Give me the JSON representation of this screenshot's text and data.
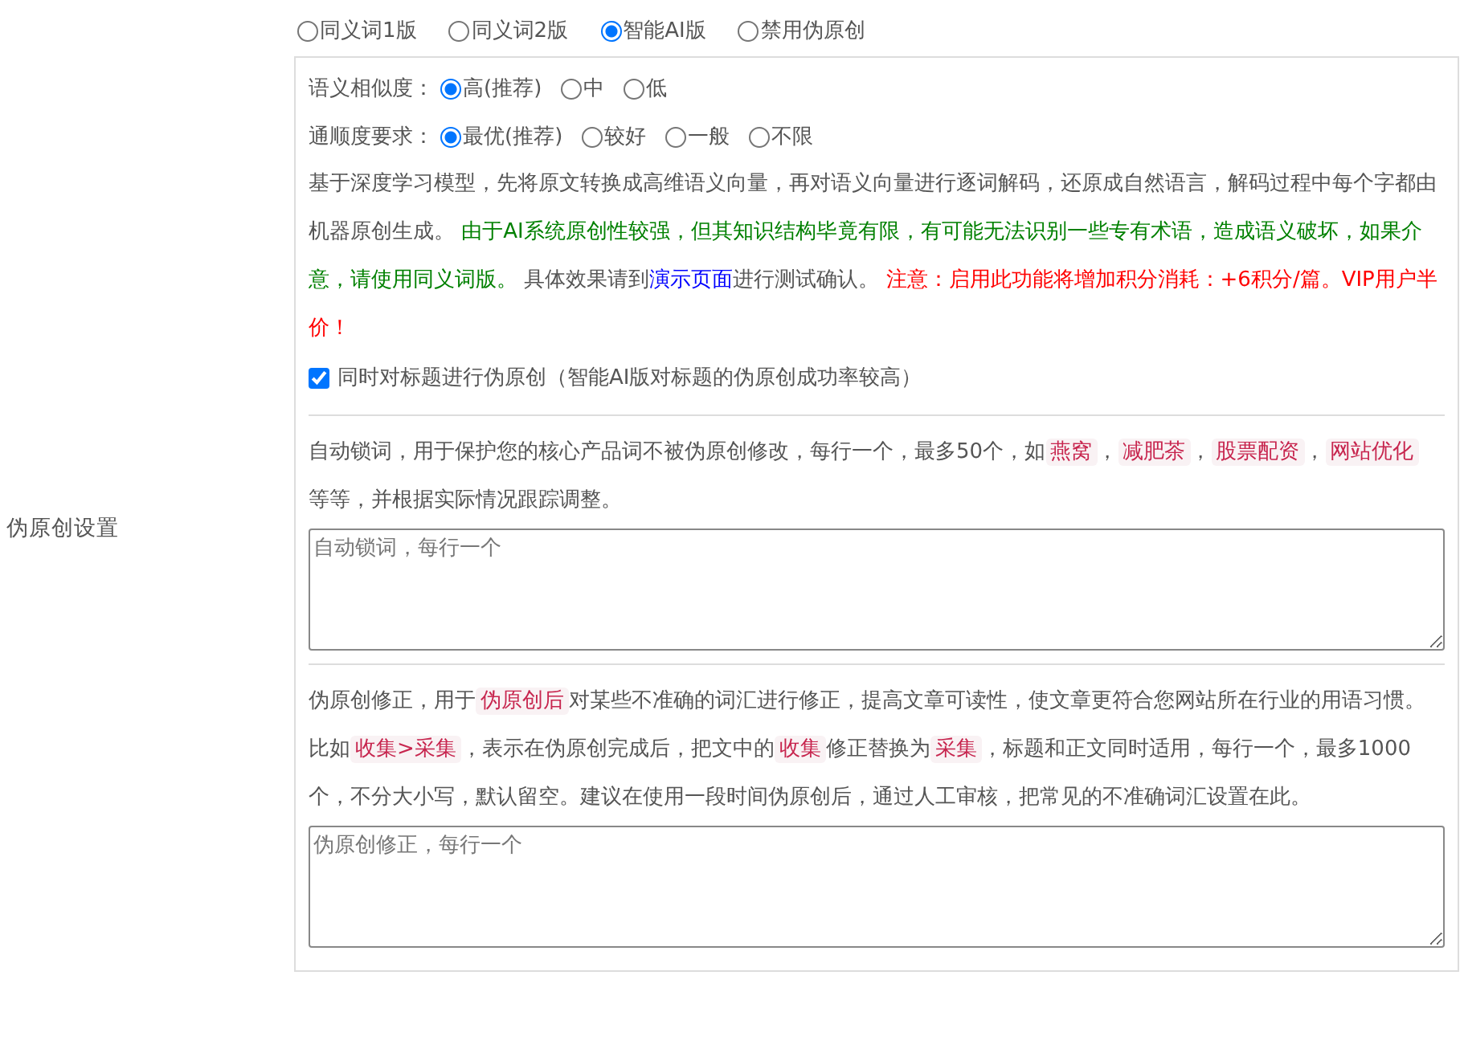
{
  "section_label": "伪原创设置",
  "version_options": [
    {
      "label": "同义词1版",
      "selected": false
    },
    {
      "label": "同义词2版",
      "selected": false
    },
    {
      "label": "智能AI版",
      "selected": true
    },
    {
      "label": "禁用伪原创",
      "selected": false
    }
  ],
  "similarity": {
    "label": "语义相似度：",
    "options": [
      {
        "label": "高(推荐)",
        "selected": true
      },
      {
        "label": "中",
        "selected": false
      },
      {
        "label": "低",
        "selected": false
      }
    ]
  },
  "fluency": {
    "label": "通顺度要求：",
    "options": [
      {
        "label": "最优(推荐)",
        "selected": true
      },
      {
        "label": "较好",
        "selected": false
      },
      {
        "label": "一般",
        "selected": false
      },
      {
        "label": "不限",
        "selected": false
      }
    ]
  },
  "ai_description": [
    {
      "kind": "plain",
      "text": "基于深度学习模型，先将原文转换成高维语义向量，再对语义向量进行逐词解码，还原成自然语言，解码过程中每个字都由机器原创生成。 "
    },
    {
      "kind": "green",
      "text": "由于AI系统原创性较强，但其知识结构毕竟有限，有可能无法识别一些专有术语，造成语义破坏，如果介意，请使用同义词版。"
    },
    {
      "kind": "plain",
      "text": " 具体效果请到"
    },
    {
      "kind": "link",
      "text": "演示页面"
    },
    {
      "kind": "plain",
      "text": "进行测试确认。 "
    },
    {
      "kind": "red",
      "text": "注意：启用此功能将增加积分消耗：+6积分/篇。VIP用户半价！"
    }
  ],
  "title_option": {
    "label": "同时对标题进行伪原创（智能AI版对标题的伪原创成功率较高）",
    "checked": true
  },
  "lock_words": {
    "description": [
      {
        "kind": "plain",
        "text": "自动锁词，用于保护您的核心产品词不被伪原创修改，每行一个，最多50个，如"
      },
      {
        "kind": "code",
        "text": "燕窝"
      },
      {
        "kind": "plain",
        "text": "，"
      },
      {
        "kind": "code",
        "text": "减肥茶"
      },
      {
        "kind": "plain",
        "text": "，"
      },
      {
        "kind": "code",
        "text": "股票配资"
      },
      {
        "kind": "plain",
        "text": "，"
      },
      {
        "kind": "code",
        "text": "网站优化"
      },
      {
        "kind": "plain",
        "text": " 等等，并根据实际情况跟踪调整。"
      }
    ],
    "placeholder": "自动锁词，每行一个"
  },
  "corrections": {
    "description": [
      {
        "kind": "plain",
        "text": "伪原创修正，用于"
      },
      {
        "kind": "code",
        "text": "伪原创后"
      },
      {
        "kind": "plain",
        "text": "对某些不准确的词汇进行修正，提高文章可读性，使文章更符合您网站所在行业的用语习惯。比如"
      },
      {
        "kind": "code",
        "text": "收集>采集"
      },
      {
        "kind": "plain",
        "text": "，表示在伪原创完成后，把文中的"
      },
      {
        "kind": "code",
        "text": "收集"
      },
      {
        "kind": "plain",
        "text": "修正替换为"
      },
      {
        "kind": "code",
        "text": "采集"
      },
      {
        "kind": "plain",
        "text": "，标题和正文同时适用，每行一个，最多1000个，不分大小写，默认留空。建议在使用一段时间伪原创后，通过人工审核，把常见的不准确词汇设置在此。"
      }
    ],
    "placeholder": "伪原创修正，每行一个"
  }
}
